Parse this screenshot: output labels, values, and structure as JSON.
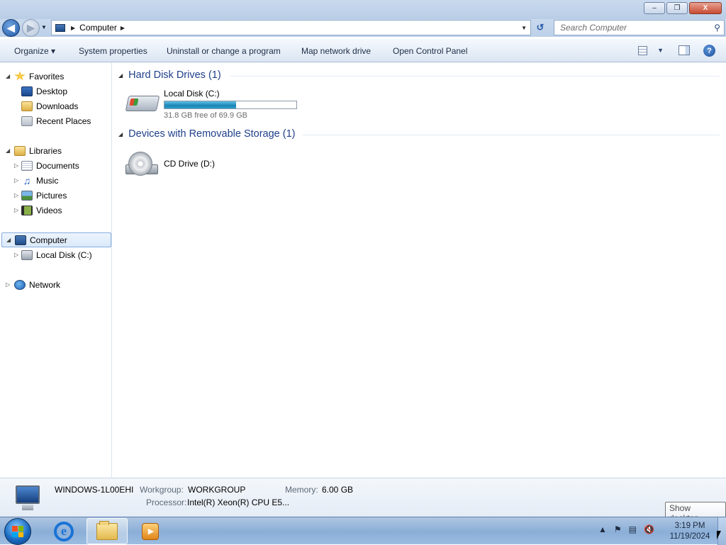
{
  "window": {
    "minimize_label": "–",
    "restore_label": "❐",
    "close_label": "X"
  },
  "address": {
    "crumb": "Computer",
    "search_placeholder": "Search Computer"
  },
  "toolbar": {
    "organize": "Organize ▾",
    "system_properties": "System properties",
    "uninstall": "Uninstall or change a program",
    "map_network": "Map network drive",
    "open_control_panel": "Open Control Panel",
    "help": "?"
  },
  "nav": {
    "favorites": "Favorites",
    "desktop": "Desktop",
    "downloads": "Downloads",
    "recent_places": "Recent Places",
    "libraries": "Libraries",
    "documents": "Documents",
    "music": "Music",
    "pictures": "Pictures",
    "videos": "Videos",
    "computer": "Computer",
    "local_disk": "Local Disk (C:)",
    "network": "Network"
  },
  "content": {
    "group_hdd": "Hard Disk Drives (1)",
    "group_removable": "Devices with Removable Storage (1)",
    "local_disk_name": "Local Disk (C:)",
    "local_disk_free": "31.8 GB free of 69.9 GB",
    "local_disk_used_fraction": 0.545,
    "cd_drive_name": "CD Drive (D:)"
  },
  "details": {
    "computer_name": "WINDOWS-1L00EHI",
    "workgroup_label": "Workgroup:",
    "workgroup_value": "WORKGROUP",
    "memory_label": "Memory:",
    "memory_value": "6.00 GB",
    "processor_label": "Processor:",
    "processor_value": "Intel(R) Xeon(R) CPU E5..."
  },
  "taskbar": {
    "ie_glyph": "e",
    "time": "3:19 PM",
    "date": "11/19/2024",
    "tooltip": "Show desktop"
  }
}
